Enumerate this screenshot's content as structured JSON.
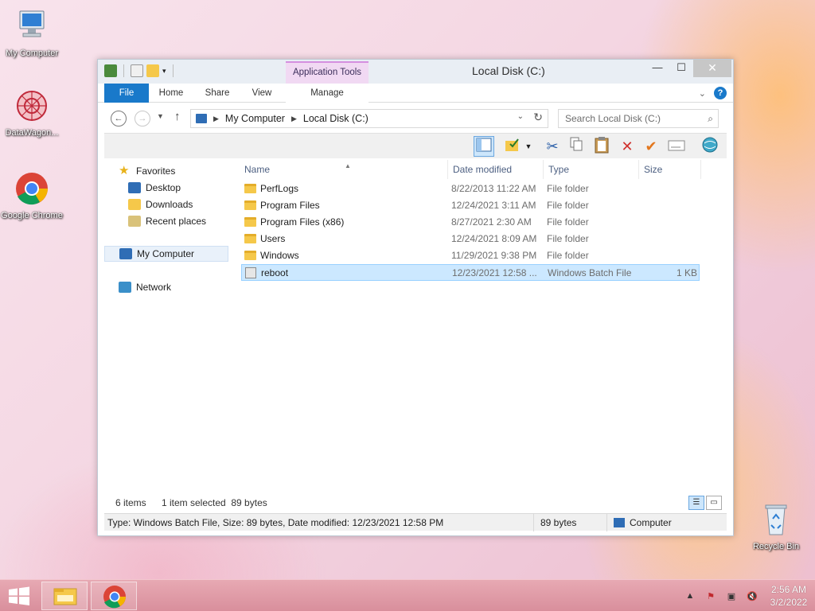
{
  "desktop": {
    "icons": [
      {
        "label": "My Computer"
      },
      {
        "label": "DataWagon..."
      },
      {
        "label": "Google Chrome"
      },
      {
        "label": "Recycle Bin"
      }
    ]
  },
  "window": {
    "title": "Local Disk (C:)",
    "contextual_tab_group": "Application Tools",
    "ribbon_tabs": {
      "file": "File",
      "home": "Home",
      "share": "Share",
      "view": "View",
      "manage": "Manage"
    },
    "controls": {
      "minimize": "—",
      "maximize": "☐",
      "close": "✕"
    },
    "help": "?"
  },
  "address": {
    "crumbs": [
      "My Computer",
      "Local Disk (C:)"
    ],
    "search_placeholder": "Search Local Disk (C:)"
  },
  "navpane": {
    "favorites": "Favorites",
    "desktop": "Desktop",
    "downloads": "Downloads",
    "recent": "Recent places",
    "computer": "My Computer",
    "network": "Network"
  },
  "columns": {
    "name": "Name",
    "date": "Date modified",
    "type": "Type",
    "size": "Size"
  },
  "files": [
    {
      "name": "PerfLogs",
      "date": "8/22/2013 11:22 AM",
      "type": "File folder",
      "size": "",
      "kind": "folder"
    },
    {
      "name": "Program Files",
      "date": "12/24/2021 3:11 AM",
      "type": "File folder",
      "size": "",
      "kind": "folder"
    },
    {
      "name": "Program Files (x86)",
      "date": "8/27/2021 2:30 AM",
      "type": "File folder",
      "size": "",
      "kind": "folder"
    },
    {
      "name": "Users",
      "date": "12/24/2021 8:09 AM",
      "type": "File folder",
      "size": "",
      "kind": "folder"
    },
    {
      "name": "Windows",
      "date": "11/29/2021 9:38 PM",
      "type": "File folder",
      "size": "",
      "kind": "folder"
    },
    {
      "name": "reboot",
      "date": "12/23/2021 12:58 ...",
      "type": "Windows Batch File",
      "size": "1 KB",
      "kind": "batch",
      "selected": true
    }
  ],
  "status": {
    "items": "6 items",
    "selection": "1 item selected  89 bytes",
    "details": "Type: Windows Batch File, Size: 89 bytes, Date modified: 12/23/2021 12:58 PM",
    "size": "89 bytes",
    "location": "Computer"
  },
  "taskbar": {
    "time": "2:56 AM",
    "date": "3/2/2022"
  },
  "colors": {
    "accent": "#1979ca",
    "selection": "#cce8ff",
    "folder": "#f5c84a"
  }
}
